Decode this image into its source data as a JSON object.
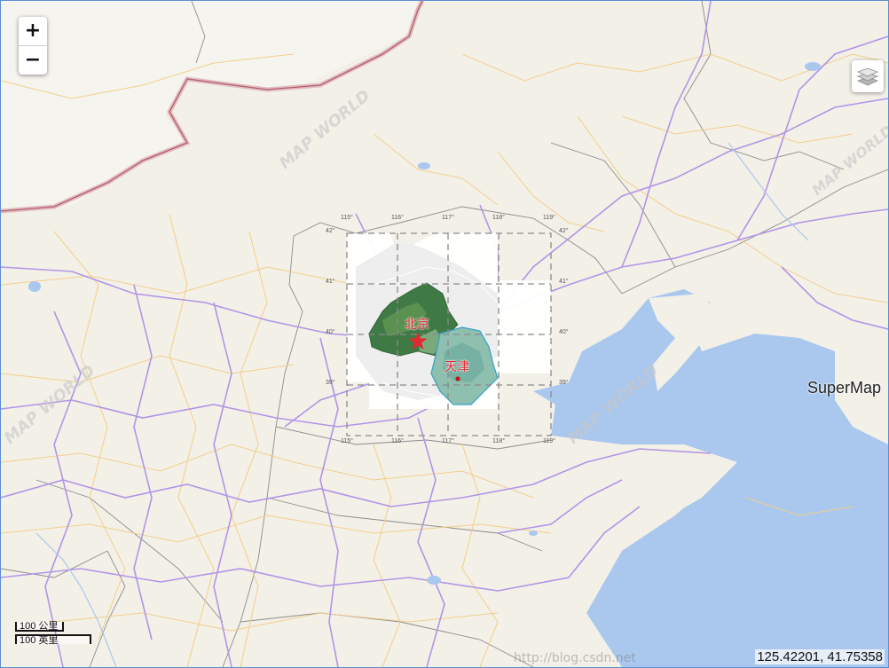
{
  "map": {
    "zoom_in_label": "+",
    "zoom_out_label": "−",
    "layers_icon": "layers-icon",
    "brand": "SuperMap",
    "watermark": "MAP WORLD",
    "watermark_url": "http://blog.csdn.net",
    "scale_metric": "100 公里",
    "scale_imperial": "100 英里",
    "coordinates": "125.42201, 41.75358",
    "cities": [
      {
        "name": "北京",
        "symbol": "star"
      },
      {
        "name": "天津",
        "symbol": "dot"
      }
    ],
    "graticule_lon": [
      "115°",
      "116°",
      "117°",
      "118°",
      "119°"
    ],
    "graticule_lat": [
      "42°",
      "41°",
      "40°",
      "39°"
    ],
    "colors": {
      "land": "#f3f0e8",
      "sea": "#aac7ee",
      "highway": "#c9a7e9",
      "road": "#f7d9a0",
      "border": "#c77a86",
      "city_marker": "#e6272d"
    }
  }
}
